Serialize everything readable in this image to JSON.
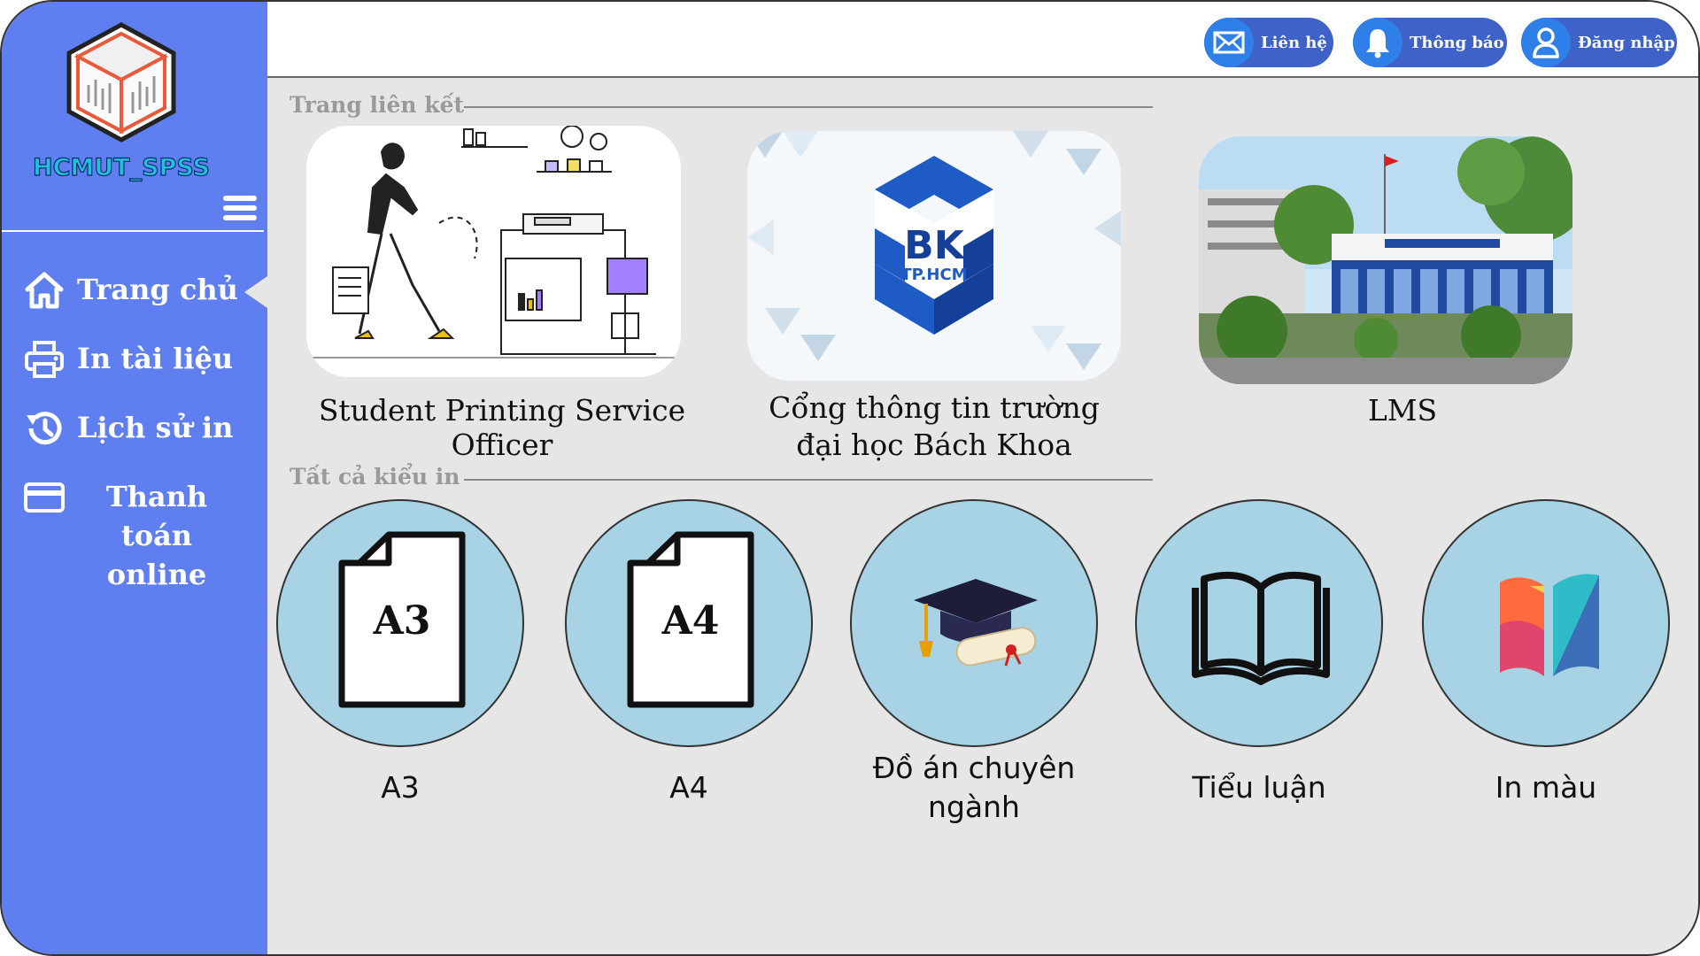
{
  "sidebar": {
    "brand": "HCMUT_SPSS",
    "items": [
      {
        "label": "Trang chủ",
        "icon": "home-icon"
      },
      {
        "label": "In tài liệu",
        "icon": "printer-icon"
      },
      {
        "label": "Lịch sử in",
        "icon": "history-icon"
      },
      {
        "label": "Thanh toán online",
        "icon": "credit-card-icon"
      }
    ],
    "colors": {
      "background": "#5f7ff0",
      "brand_text": "#1fc0e0"
    }
  },
  "header": {
    "contact_label": "Liên hệ",
    "notifications_label": "Thông báo",
    "login_label": "Đăng nhập",
    "pill_color": "#3f62c9"
  },
  "links_section": {
    "title": "Trang liên kết",
    "cards": [
      {
        "caption": "Student Printing Service Officer",
        "image": "printing-illustration"
      },
      {
        "caption_line1": "Cổng thông tin trường",
        "caption_line2": "đại học Bách Khoa",
        "image": "bk-logo",
        "logo_main": "BK",
        "logo_sub": "TP.HCM"
      },
      {
        "caption": "LMS",
        "image": "campus-building-photo"
      }
    ]
  },
  "types_section": {
    "title": "Tất cả kiểu in",
    "items": [
      {
        "label": "A3",
        "icon_text": "A3",
        "icon": "a3-document-icon"
      },
      {
        "label": "A4",
        "icon_text": "A4",
        "icon": "a4-document-icon"
      },
      {
        "label_line1": "Đồ án chuyên",
        "label_line2": "ngành",
        "icon": "graduation-cap-icon"
      },
      {
        "label": "Tiểu luận",
        "icon": "open-book-icon"
      },
      {
        "label": "In màu",
        "icon": "color-book-icon"
      }
    ],
    "circle_color": "#a8d3e4"
  }
}
